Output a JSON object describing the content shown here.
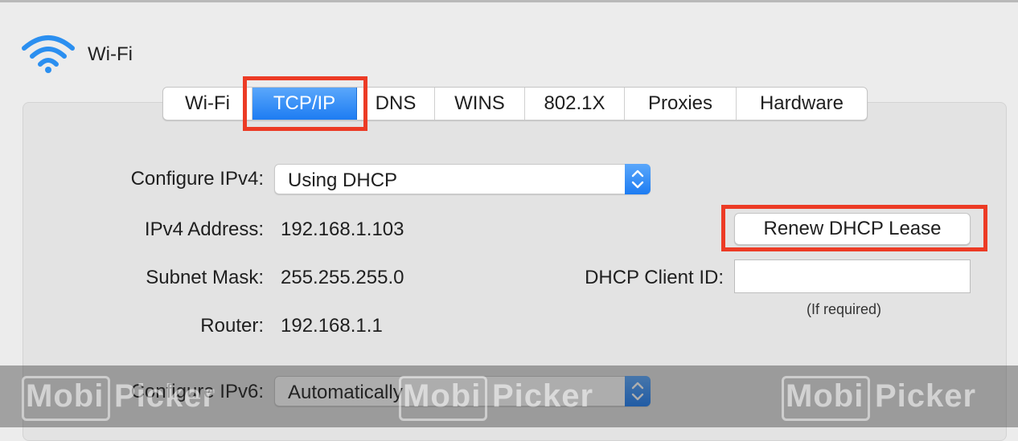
{
  "window": {
    "title": "Wi-Fi",
    "icon": "wifi-icon"
  },
  "tabs": [
    {
      "label": "Wi-Fi",
      "active": false
    },
    {
      "label": "TCP/IP",
      "active": true
    },
    {
      "label": "DNS",
      "active": false
    },
    {
      "label": "WINS",
      "active": false
    },
    {
      "label": "802.1X",
      "active": false
    },
    {
      "label": "Proxies",
      "active": false
    },
    {
      "label": "Hardware",
      "active": false
    }
  ],
  "ipv4": {
    "configure_label": "Configure IPv4:",
    "configure_value": "Using DHCP",
    "address_label": "IPv4 Address:",
    "address_value": "192.168.1.103",
    "subnet_label": "Subnet Mask:",
    "subnet_value": "255.255.255.0",
    "router_label": "Router:",
    "router_value": "192.168.1.1"
  },
  "dhcp": {
    "renew_button": "Renew DHCP Lease",
    "client_id_label": "DHCP Client ID:",
    "client_id_value": "",
    "client_id_hint": "(If required)"
  },
  "ipv6": {
    "configure_label": "Configure IPv6:",
    "configure_value": "Automatically"
  },
  "watermark": {
    "text_left": "Mobi",
    "text_right": "Picker"
  },
  "colors": {
    "accent": "#1d7cf2",
    "highlight": "#ec3b25",
    "background": "#ececec"
  }
}
